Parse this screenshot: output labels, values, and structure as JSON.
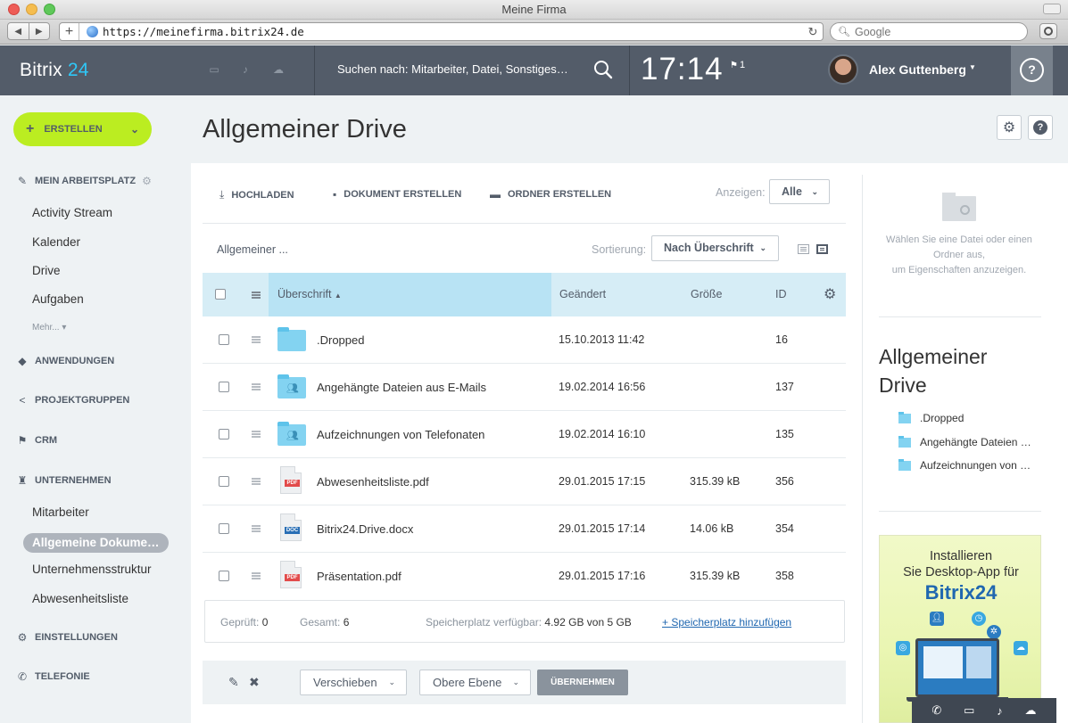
{
  "browser": {
    "window_title": "Meine Firma",
    "url": "https://meinefirma.bitrix24.de",
    "search_placeholder": "Google"
  },
  "header": {
    "logo_text": "Bitrix",
    "logo_num": "24",
    "search_text": "Suchen nach: Mitarbeiter, Datei, Sonstiges…",
    "time": "17:14",
    "flag_count": "1",
    "user_name": "Alex Guttenberg",
    "help_label": "?"
  },
  "sidebar": {
    "create_label": "ERSTELLEN",
    "sections": {
      "workspace": "MEIN ARBEITSPLATZ",
      "apps": "ANWENDUNGEN",
      "groups": "PROJEKTGRUPPEN",
      "crm": "CRM",
      "company": "UNTERNEHMEN",
      "settings": "EINSTELLUNGEN",
      "telephony": "TELEFONIE"
    },
    "workspace_items": [
      "Activity Stream",
      "Kalender",
      "Drive",
      "Aufgaben"
    ],
    "more_label": "Mehr...",
    "company_items": [
      "Mitarbeiter",
      "Allgemeine Dokume…",
      "Unternehmensstruktur",
      "Abwesenheitsliste"
    ]
  },
  "page": {
    "title": "Allgemeiner Drive"
  },
  "actions": {
    "upload": "HOCHLADEN",
    "create_doc": "DOKUMENT ERSTELLEN",
    "create_folder": "ORDNER ERSTELLEN",
    "show_label": "Anzeigen:",
    "show_value": "Alle"
  },
  "toolbar2": {
    "breadcrumb": "Allgemeiner ...",
    "sort_label": "Sortierung:",
    "sort_value": "Nach Überschrift"
  },
  "table": {
    "columns": {
      "title": "Überschrift",
      "changed": "Geändert",
      "size": "Größe",
      "id": "ID"
    },
    "sort_indicator": "▲",
    "rows": [
      {
        "name": ".Dropped",
        "date": "15.10.2013 11:42",
        "size": "",
        "id": "16",
        "icon": "folder-icon"
      },
      {
        "name": "Angehängte Dateien aus E-Mails",
        "date": "19.02.2014 16:56",
        "size": "",
        "id": "137",
        "icon": "shared-folder-icon"
      },
      {
        "name": "Aufzeichnungen von Telefonaten",
        "date": "19.02.2014 16:10",
        "size": "",
        "id": "135",
        "icon": "shared-folder-icon"
      },
      {
        "name": "Abwesenheitsliste.pdf",
        "date": "29.01.2015 17:15",
        "size": "315.39 kB",
        "id": "356",
        "icon": "pdf-file-icon",
        "tag": "PDF"
      },
      {
        "name": "Bitrix24.Drive.docx",
        "date": "29.01.2015 17:14",
        "size": "14.06 kB",
        "id": "354",
        "icon": "doc-file-icon",
        "tag": "DOC"
      },
      {
        "name": "Präsentation.pdf",
        "date": "29.01.2015 17:16",
        "size": "315.39 kB",
        "id": "358",
        "icon": "pdf-file-icon",
        "tag": "PDF"
      }
    ]
  },
  "stats": {
    "checked_label": "Geprüft:",
    "checked_value": "0",
    "total_label": "Gesamt:",
    "total_value": "6",
    "storage_label": "Speicherplatz verfügbar:",
    "storage_value": "4.92 GB von 5 GB",
    "add_storage": "+ Speicherplatz hinzufügen"
  },
  "actionbar": {
    "move_label": "Verschieben",
    "level_label": "Obere Ebene",
    "apply_label": "ÜBERNEHMEN"
  },
  "info_panel": {
    "hint_line1": "Wählen Sie eine Datei oder einen",
    "hint_line2": "Ordner aus,",
    "hint_line3": "um Eigenschaften anzuzeigen.",
    "title_line1": "Allgemeiner",
    "title_line2": "Drive",
    "items": [
      ".Dropped",
      "Angehängte Dateien …",
      "Aufzeichnungen von …"
    ]
  },
  "promo": {
    "line1": "Installieren",
    "line2": "Sie Desktop-App für",
    "brand": "Bitrix24"
  },
  "colors": {
    "header_bg": "#535c69",
    "accent_blue": "#2fc7f7",
    "create_green": "#bbed21",
    "table_header": "#d6edf6",
    "table_header_sorted": "#b8e3f4",
    "link_blue": "#2067b0"
  }
}
